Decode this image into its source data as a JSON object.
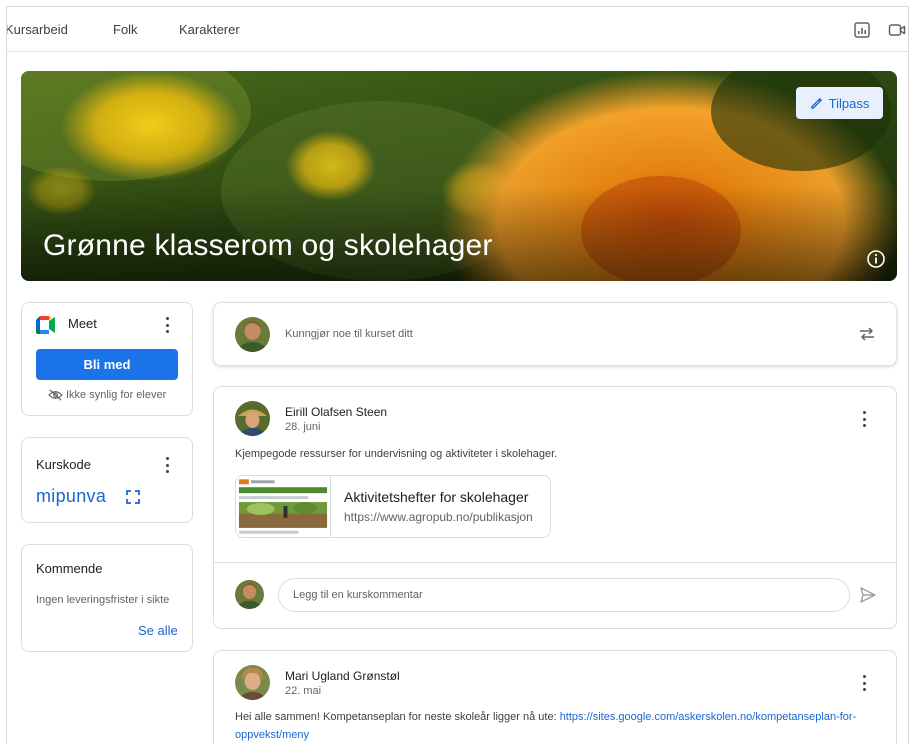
{
  "nav": {
    "tabs": [
      "Kursarbeid",
      "Folk",
      "Karakterer"
    ],
    "icons": [
      "gradebook-icon",
      "video-icon"
    ]
  },
  "banner": {
    "title": "Grønne klasserom og skolehager",
    "customize_label": "Tilpass",
    "accent": "#1967d2"
  },
  "meet": {
    "label": "Meet",
    "join_label": "Bli med",
    "visibility_note": "Ikke synlig for elever"
  },
  "class_code": {
    "label": "Kurskode",
    "code": "mipunva"
  },
  "upcoming": {
    "label": "Kommende",
    "empty_text": "Ingen leveringsfrister i sikte",
    "see_all_label": "Se alle"
  },
  "announce": {
    "placeholder": "Kunngjør noe til kurset ditt"
  },
  "posts": [
    {
      "author": "Eirill Olafsen Steen",
      "date": "28. juni",
      "text": "Kjempegode ressurser for undervisning og aktiviteter i skolehager.",
      "attachment": {
        "title": "Aktivitetshefter for skolehager",
        "url": "https://www.agropub.no/publikasjoner"
      },
      "comment_placeholder": "Legg til en kurskommentar"
    },
    {
      "author": "Mari Ugland Grønstøl",
      "date": "22. mai",
      "text": "Hei alle sammen! Kompetanseplan for neste skoleår ligger nå ute: ",
      "link": "https://sites.google.com/askerskolen.no/kompetanseplan-for-oppvekst/meny"
    }
  ]
}
